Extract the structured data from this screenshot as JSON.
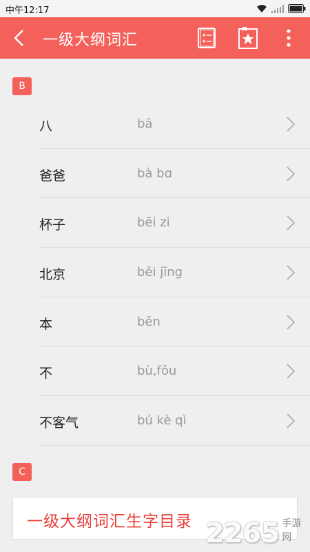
{
  "status_bar": {
    "time": "中午12:17",
    "icons": [
      "wifi-icon",
      "signal-icon",
      "battery-icon"
    ]
  },
  "app_bar": {
    "title": "一级大纲词汇",
    "back_icon": "chevron-left-icon",
    "actions": [
      "word-list-icon",
      "bookmark-star-icon",
      "more-vertical-icon"
    ]
  },
  "sections": [
    {
      "letter": "B",
      "words": [
        {
          "hanzi": "八",
          "pinyin": "bā"
        },
        {
          "hanzi": "爸爸",
          "pinyin": "bà bɑ"
        },
        {
          "hanzi": "杯子",
          "pinyin": "bēi zi"
        },
        {
          "hanzi": "北京",
          "pinyin": "běi jīng"
        },
        {
          "hanzi": "本",
          "pinyin": "běn"
        },
        {
          "hanzi": "不",
          "pinyin": "bù,fǒu"
        },
        {
          "hanzi": "不客气",
          "pinyin": "bú kè qì"
        }
      ]
    },
    {
      "letter": "C",
      "words": []
    }
  ],
  "bottom_card": {
    "label": "一级大纲词汇生字目录"
  },
  "watermark": {
    "number": "2265",
    "site": "手游网"
  },
  "colors": {
    "accent": "#f4615a",
    "bottom_text": "#e9413a"
  }
}
